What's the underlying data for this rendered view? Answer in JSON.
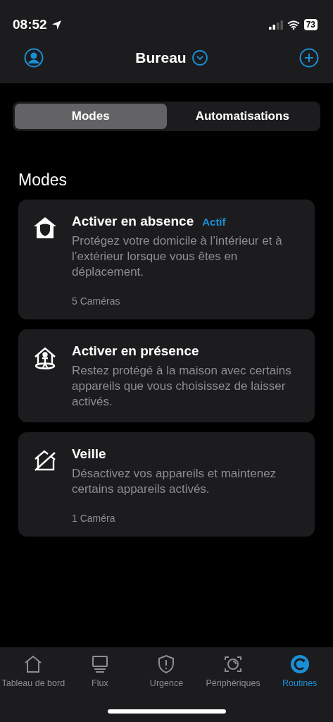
{
  "status_bar": {
    "time": "08:52",
    "battery": "73"
  },
  "header": {
    "title": "Bureau"
  },
  "segments": [
    {
      "label": "Modes",
      "selected": true
    },
    {
      "label": "Automatisations",
      "selected": false
    }
  ],
  "section_title": "Modes",
  "modes": [
    {
      "kind": "away",
      "title": "Activer en absence",
      "badge": "Actif",
      "description": "Protégez votre domicile à l’intérieur et à l’extérieur lorsque vous êtes en déplacement.",
      "count": "5 Caméras"
    },
    {
      "kind": "home",
      "title": "Activer en présence",
      "description": "Restez protégé à la maison avec certains appareils que vous choisissez de laisser activés."
    },
    {
      "kind": "standby",
      "title": "Veille",
      "description": "Désactivez vos appareils et maintenez certains appareils activés.",
      "count": "1 Caméra"
    }
  ],
  "tab_bar": [
    {
      "kind": "dashboard",
      "label": "Tableau de bord",
      "selected": false
    },
    {
      "kind": "feed",
      "label": "Flux",
      "selected": false
    },
    {
      "kind": "emergency",
      "label": "Urgence",
      "selected": false
    },
    {
      "kind": "devices",
      "label": "Périphériques",
      "selected": false
    },
    {
      "kind": "routines",
      "label": "Routines",
      "selected": true
    }
  ]
}
